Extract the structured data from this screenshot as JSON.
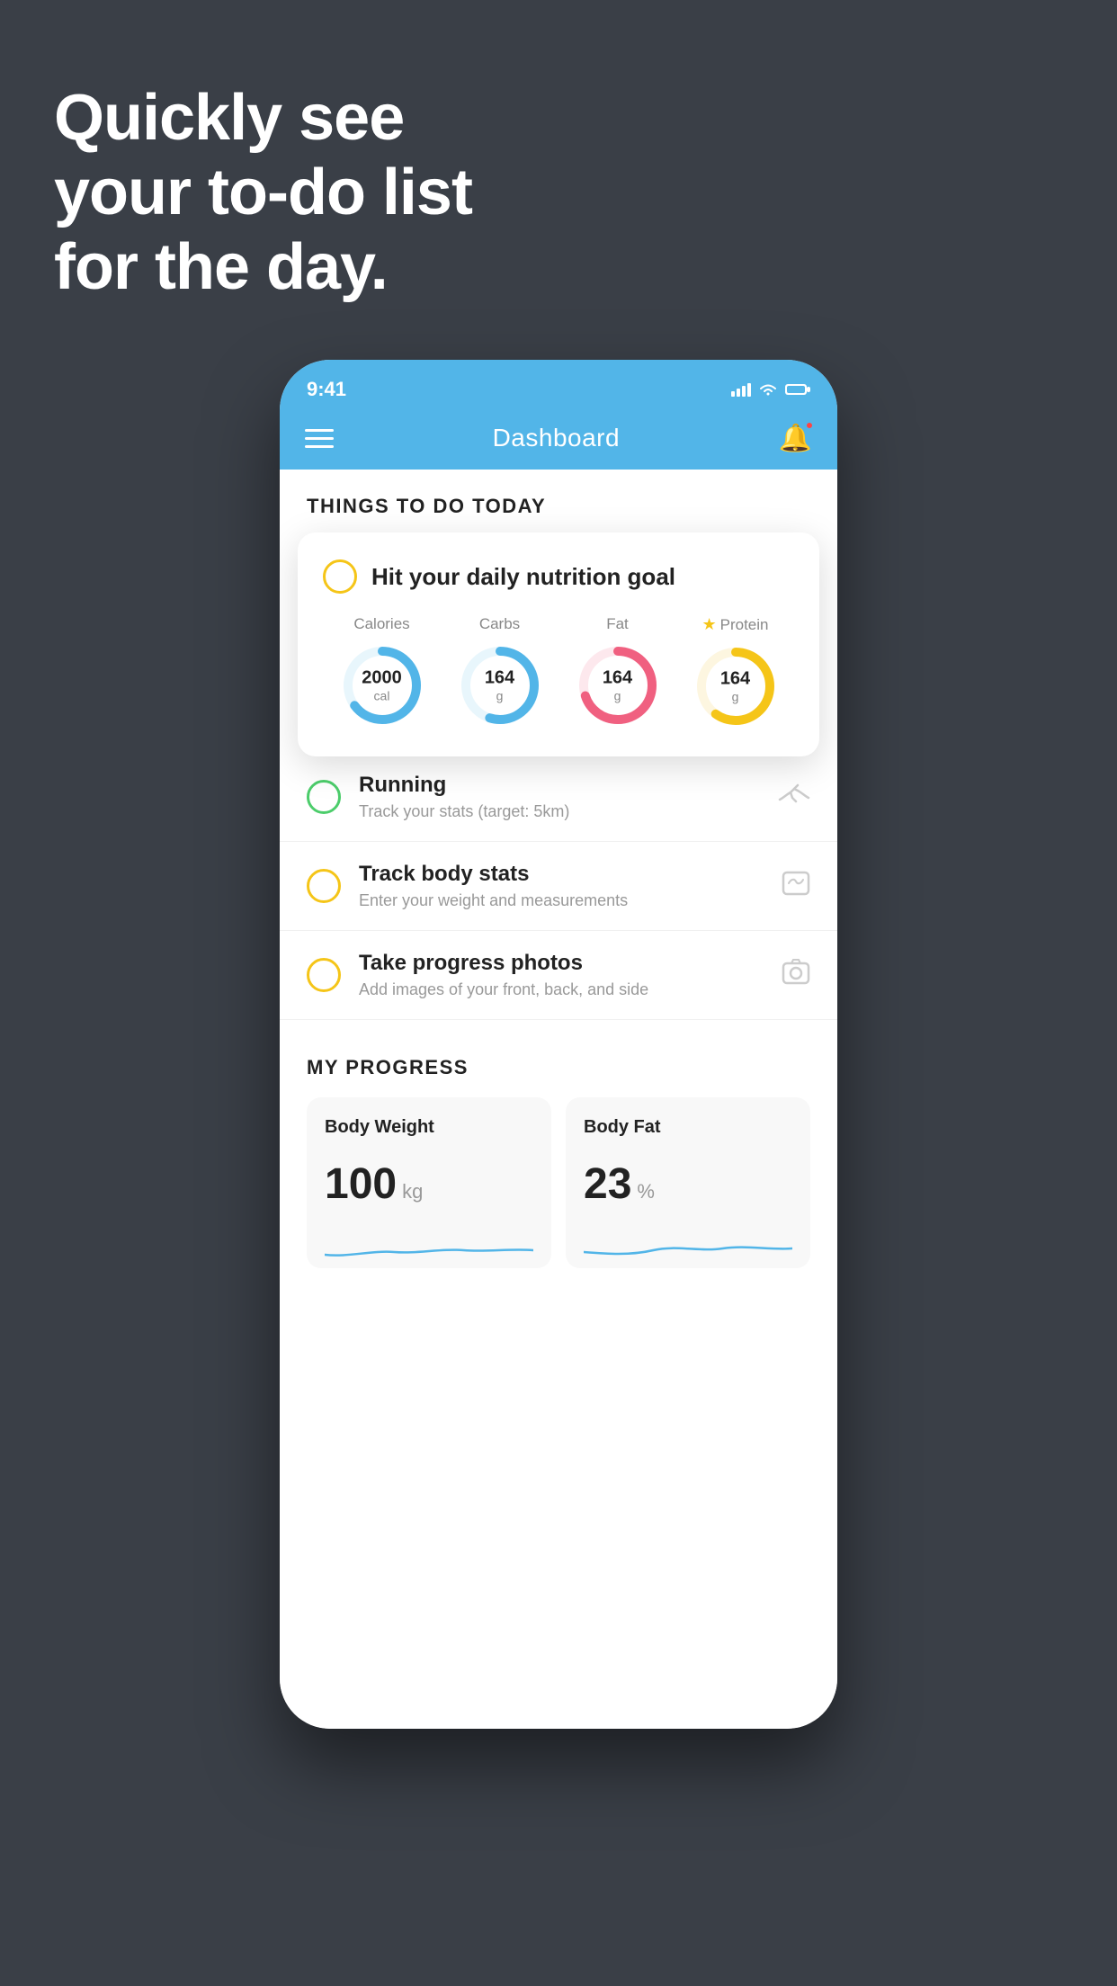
{
  "background": {
    "color": "#3a3f47"
  },
  "hero": {
    "line1": "Quickly see",
    "line2": "your to-do list",
    "line3": "for the day."
  },
  "phone": {
    "status_bar": {
      "time": "9:41",
      "signal_icon": "signal",
      "wifi_icon": "wifi",
      "battery_icon": "battery"
    },
    "nav": {
      "title": "Dashboard",
      "menu_label": "menu",
      "bell_label": "notifications"
    },
    "things_header": "THINGS TO DO TODAY",
    "featured_card": {
      "title": "Hit your daily nutrition goal",
      "items": [
        {
          "label": "Calories",
          "value": "2000",
          "unit": "cal",
          "color": "#52b5e8",
          "bg_color": "#e8f6fc",
          "percent": 65
        },
        {
          "label": "Carbs",
          "value": "164",
          "unit": "g",
          "color": "#52b5e8",
          "bg_color": "#e8f6fc",
          "percent": 55
        },
        {
          "label": "Fat",
          "value": "164",
          "unit": "g",
          "color": "#f06080",
          "bg_color": "#fde8ed",
          "percent": 70
        },
        {
          "label": "Protein",
          "value": "164",
          "unit": "g",
          "color": "#f5c518",
          "bg_color": "#fdf6e0",
          "percent": 60,
          "starred": true
        }
      ]
    },
    "task_items": [
      {
        "title": "Running",
        "subtitle": "Track your stats (target: 5km)",
        "circle_color": "#4ccd6b",
        "icon": "shoe"
      },
      {
        "title": "Track body stats",
        "subtitle": "Enter your weight and measurements",
        "circle_color": "#f5c518",
        "icon": "scale"
      },
      {
        "title": "Take progress photos",
        "subtitle": "Add images of your front, back, and side",
        "circle_color": "#f5c518",
        "icon": "photo"
      }
    ],
    "progress_section": {
      "header": "MY PROGRESS",
      "cards": [
        {
          "title": "Body Weight",
          "value": "100",
          "unit": "kg"
        },
        {
          "title": "Body Fat",
          "value": "23",
          "unit": "%"
        }
      ]
    }
  }
}
